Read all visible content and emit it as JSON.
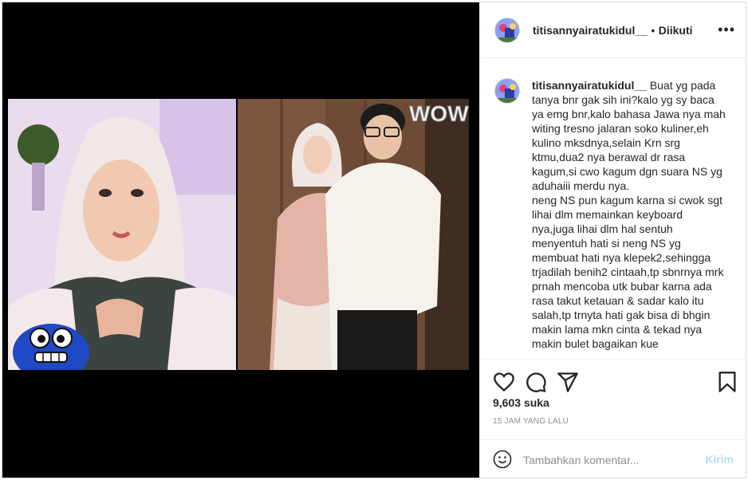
{
  "post": {
    "author": "titisannyairatukidul__",
    "follow_status": "Diikuti",
    "dot": "•",
    "more_label": "•••",
    "caption": "Buat yg pada tanya bnr gak sih ini?kalo yg sy baca ya emg bnr,kalo bahasa Jawa nya mah witing tresno jalaran soko kuliner,eh kulino mksdnya,selain Krn srg ktmu,dua2 nya berawal dr rasa kagum,si cwo kagum dgn suara NS yg aduhaiii merdu nya.\nneng NS pun kagum karna si cwok sgt lihai dlm memainkan keyboard nya,juga lihai dlm hal sentuh menyentuh hati si neng NS yg membuat hati nya klepek2,sehingga trjadilah benih2 cintaah,tp sbnrnya mrk prnah mencoba utk bubar karna ada rasa takut ketauan & sadar kalo itu salah,tp trnyta hati gak bisa di bhgin makin lama mkn cinta & tekad nya makin bulet bagaikan kue",
    "likes": "9,603 suka",
    "time_ago": "15 JAM YANG LALU"
  },
  "comment_form": {
    "placeholder": "Tambahkan komentar...",
    "post_label": "Kirim"
  },
  "photo": {
    "overlay_text": "WOW"
  },
  "icons": {
    "like": "heart-icon",
    "comment": "comment-icon",
    "share": "send-icon",
    "save": "bookmark-icon",
    "emoji": "emoji-icon",
    "more": "more-options-icon"
  },
  "colors": {
    "post_button": "#b2dffc",
    "muted_text": "#8e8e8e",
    "border": "#dbdbdb",
    "media_bg": "#000000"
  }
}
